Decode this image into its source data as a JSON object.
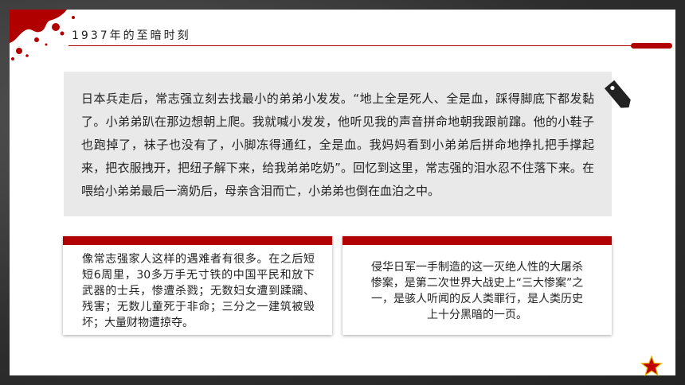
{
  "header": {
    "title": "1937年的至暗时刻"
  },
  "quote": {
    "text": "日本兵走后，常志强立刻去找最小的弟弟小发发。“地上全是死人、全是血，踩得脚底下都发黏了。小弟弟趴在那边想朝上爬。我就喊小发发，他听见我的声音拼命地朝我跟前蹿。他的小鞋子也跑掉了，袜子也没有了，小脚冻得通红，全是血。我妈妈看到小弟弟后拼命地挣扎把手撑起来，把衣服拽开，把纽子解下来，给我弟弟吃奶”。回忆到这里，常志强的泪水忍不住落下来。在喂给小弟弟最后一滴奶后，母亲含泪而亡，小弟弟也倒在血泊之中。"
  },
  "cards": [
    {
      "text": "像常志强家人这样的遇难者有很多。在之后短短6周里，30多万手无寸铁的中国平民和放下武器的士兵，惨遭杀戮；无数妇女遭到蹂躏、残害；无数儿童死于非命；三分之一建筑被毁坏；大量财物遭掠夺。"
    },
    {
      "text": "侵华日军一手制造的这一灭绝人性的大屠杀惨案，是第二次世界大战史上“三大惨案”之一，是骇人听闻的反人类罪行，是人类历史上十分黑暗的一页。"
    }
  ],
  "colors": {
    "accent": "#b00000",
    "quote_bg": "#e9e9e9",
    "frame": "#2e2e2e"
  },
  "icons": {
    "tag": "price-tag-icon",
    "splatter": "blood-splatter-decoration",
    "star": "red-star-icon"
  }
}
